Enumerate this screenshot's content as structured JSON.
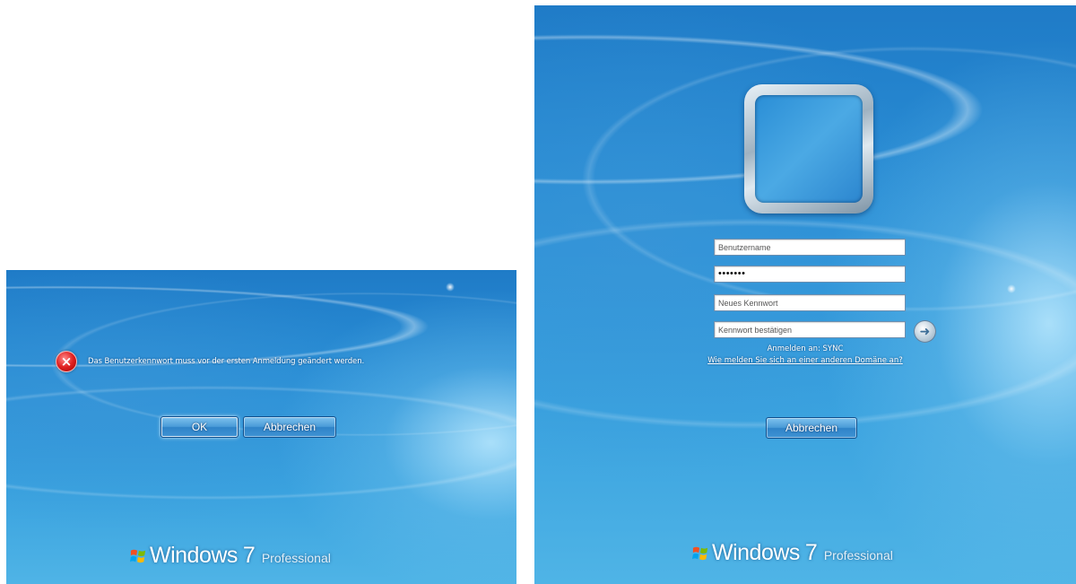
{
  "error_screen": {
    "message": "Das Benutzerkennwort muss vor der ersten Anmeldung geändert werden.",
    "ok_label": "OK",
    "cancel_label": "Abbrechen",
    "brand": {
      "windows": "Windows",
      "version": "7",
      "edition": "Professional"
    }
  },
  "logon_screen": {
    "username_placeholder": "Benutzername",
    "password_value": "•••••••",
    "new_password_placeholder": "Neues Kennwort",
    "confirm_password_placeholder": "Kennwort bestätigen",
    "submit_icon": "arrow-right",
    "logon_to": "Anmelden an: SYNC",
    "help_link": "Wie melden Sie sich an einer anderen Domäne an?",
    "cancel_label": "Abbrechen",
    "brand": {
      "windows": "Windows",
      "version": "7",
      "edition": "Professional"
    }
  },
  "colors": {
    "background_top": "#1f7bc7",
    "background_bottom": "#4fb4e6",
    "button": "#3f93d4",
    "error": "#e02020"
  }
}
